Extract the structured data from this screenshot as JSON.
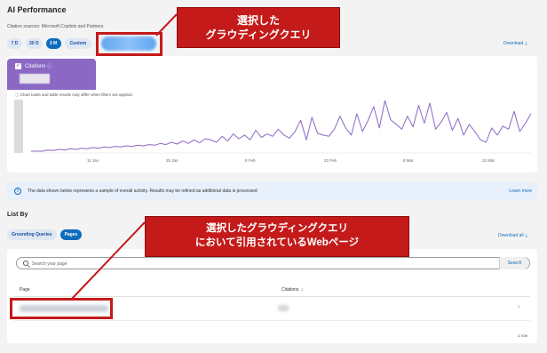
{
  "header": {
    "title": "AI Performance",
    "sources": "Citation sources: Microsoft Copilots and Partners",
    "ranges": [
      "7 D",
      "30 D",
      "3 M",
      "Custom"
    ],
    "active_range": "3 M",
    "download": "Download"
  },
  "annotations": {
    "callout_query": [
      "選択した",
      "グラウディングクエリ"
    ],
    "callout_pages": [
      "選択したグラウディングクエリ",
      "において引用されているWebページ"
    ]
  },
  "metric": {
    "label": "Citations",
    "note": "Chart totals and table results may differ when filters are applied."
  },
  "chart_data": {
    "type": "line",
    "x_tick_labels": [
      "11 Jan",
      "25 Jan",
      "8 Feb",
      "22 Feb",
      "8 Mar",
      "22 Mar"
    ],
    "y": [
      3,
      3,
      3,
      5,
      4,
      6,
      5,
      7,
      6,
      8,
      7,
      9,
      8,
      10,
      9,
      11,
      10,
      12,
      11,
      13,
      12,
      14,
      13,
      16,
      14,
      18,
      15,
      20,
      16,
      22,
      17,
      24,
      22,
      18,
      28,
      20,
      32,
      24,
      30,
      22,
      38,
      26,
      32,
      28,
      40,
      30,
      25,
      36,
      55,
      22,
      60,
      33,
      30,
      28,
      40,
      62,
      42,
      30,
      66,
      36,
      55,
      78,
      42,
      88,
      56,
      48,
      40,
      62,
      44,
      80,
      50,
      84,
      40,
      52,
      68,
      38,
      58,
      30,
      48,
      36,
      22,
      18,
      42,
      30,
      45,
      40,
      70,
      36,
      50,
      66
    ],
    "line_color": "#8a68c4",
    "grid": false
  },
  "banner": {
    "text": "The data shown below represents a sample of overall activity. Results may be refined as additional data is processed",
    "link": "Learn more"
  },
  "list": {
    "title": "List By",
    "tabs": [
      "Grounding Queries",
      "Pages"
    ],
    "active_tab": "Pages",
    "download_all": "Download all",
    "search_placeholder": "Search your page",
    "search_button": "Search",
    "columns": [
      "Page",
      "Citations"
    ],
    "row_count": "1 row"
  }
}
